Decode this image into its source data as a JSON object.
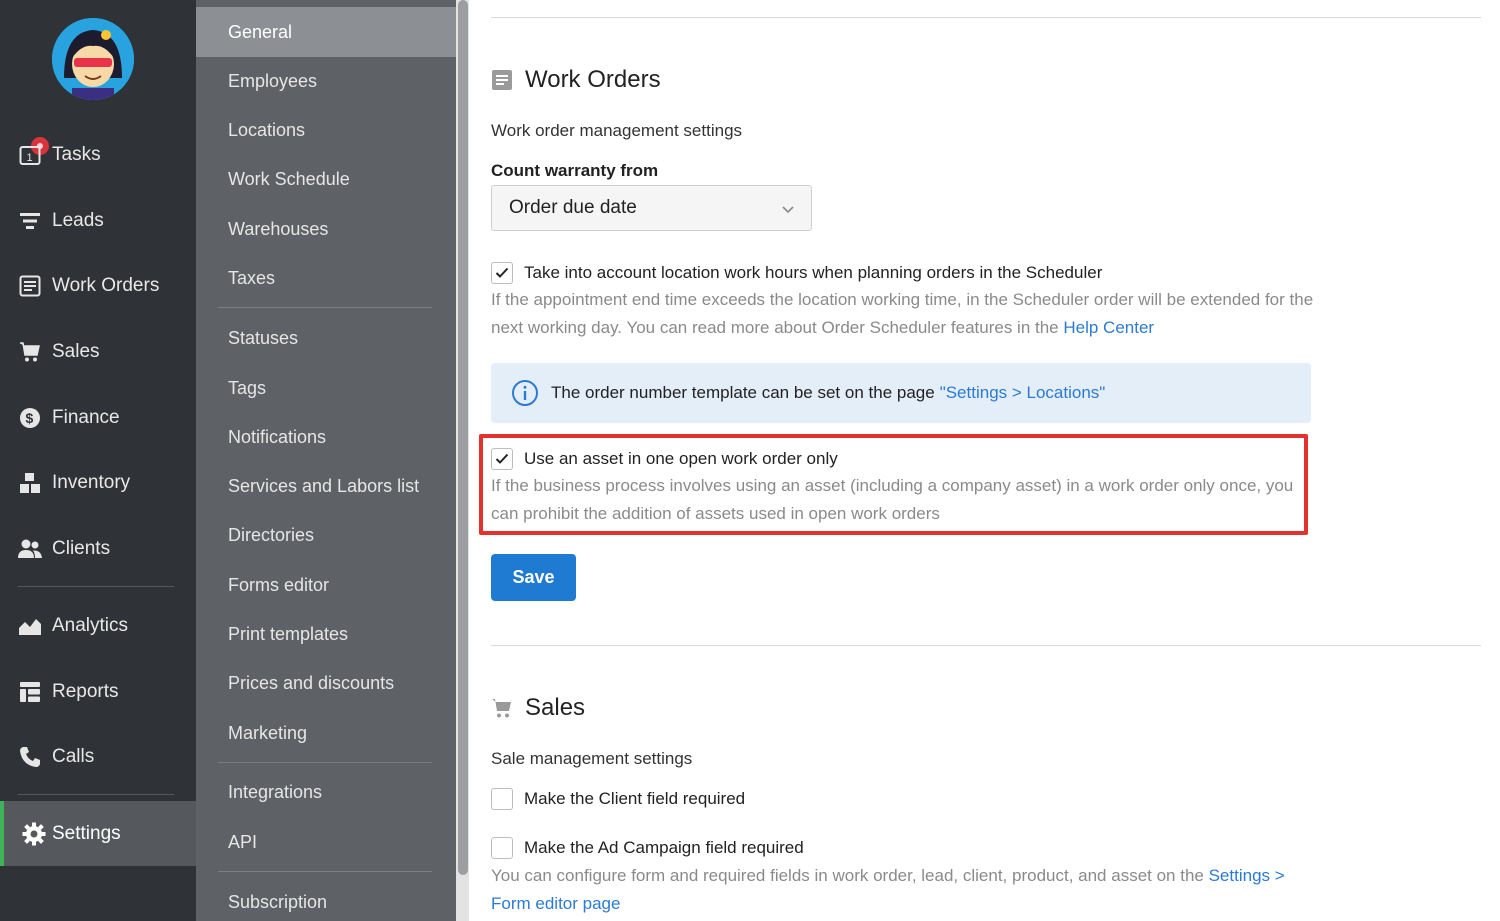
{
  "leftnav": {
    "items": [
      {
        "label": "Tasks",
        "icon": "tasks-icon",
        "badge_count": "1"
      },
      {
        "label": "Leads",
        "icon": "filter-icon"
      },
      {
        "label": "Work Orders",
        "icon": "work-order-icon"
      },
      {
        "label": "Sales",
        "icon": "cart-icon"
      },
      {
        "label": "Finance",
        "icon": "dollar-icon"
      },
      {
        "label": "Inventory",
        "icon": "boxes-icon"
      },
      {
        "label": "Clients",
        "icon": "users-icon"
      },
      {
        "label": "Analytics",
        "icon": "analytics-icon"
      },
      {
        "label": "Reports",
        "icon": "table-icon"
      },
      {
        "label": "Calls",
        "icon": "phone-icon"
      },
      {
        "label": "Settings",
        "icon": "gear-icon",
        "active": true
      }
    ]
  },
  "subnav": {
    "items": [
      "General",
      "Employees",
      "Locations",
      "Work Schedule",
      "Warehouses",
      "Taxes",
      "Statuses",
      "Tags",
      "Notifications",
      "Services and Labors list",
      "Directories",
      "Forms editor",
      "Print templates",
      "Prices and discounts",
      "Marketing",
      "Integrations",
      "API",
      "Subscription"
    ],
    "active": "General"
  },
  "work_orders": {
    "title": "Work Orders",
    "subtitle": "Work order management settings",
    "count_warranty_label": "Count warranty from",
    "count_warranty_value": "Order due date",
    "location_hours": {
      "label": "Take into account location work hours when planning orders in the Scheduler",
      "checked": true,
      "helper": "If the appointment end time exceeds the location working time, in the Scheduler order will be extended for the next working day. You can read more about Order Scheduler features in the",
      "helper_link": "Help Center"
    },
    "info": {
      "text": "The order number template can be set on the page",
      "link": "\"Settings > Locations\""
    },
    "asset_once": {
      "label": "Use an asset in one open work order only",
      "checked": true,
      "helper": "If the business process involves using an asset (including a company asset) in a work order only once, you can prohibit the addition of assets used in open work orders"
    },
    "save_label": "Save"
  },
  "sales": {
    "title": "Sales",
    "subtitle": "Sale management settings",
    "client_required": {
      "label": "Make the Client field required",
      "checked": false
    },
    "ad_campaign_required": {
      "label": "Make the Ad Campaign field required",
      "checked": false,
      "helper": "You can configure form and required fields in work order, lead, client, product, and asset on the",
      "helper_link": "Settings > Form editor page"
    }
  },
  "colors": {
    "accent": "#1f7bd1",
    "highlight": "#e4312b",
    "active_indicator": "#3fb35a"
  }
}
